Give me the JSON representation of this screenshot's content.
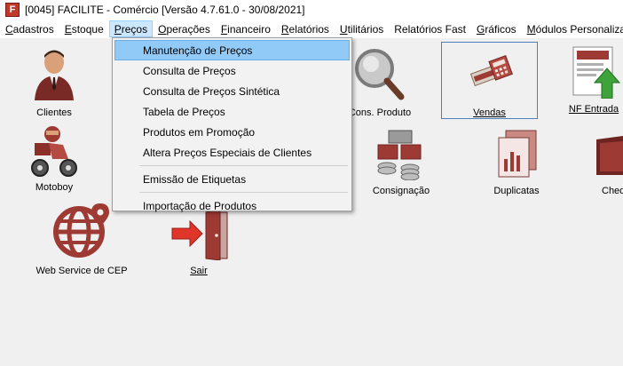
{
  "window": {
    "title": "[0045] FACILITE - Comércio [Versão 4.7.61.0 - 30/08/2021]",
    "icon_letter": "F"
  },
  "menubar": {
    "items": [
      {
        "pre": "",
        "u": "C",
        "post": "adastros"
      },
      {
        "pre": "",
        "u": "E",
        "post": "stoque"
      },
      {
        "pre": "",
        "u": "P",
        "post": "reços"
      },
      {
        "pre": "",
        "u": "O",
        "post": "perações"
      },
      {
        "pre": "",
        "u": "F",
        "post": "inanceiro"
      },
      {
        "pre": "",
        "u": "R",
        "post": "elatórios"
      },
      {
        "pre": "",
        "u": "U",
        "post": "tilitários"
      },
      {
        "pre": "Relatórios Fast",
        "u": "",
        "post": ""
      },
      {
        "pre": "",
        "u": "G",
        "post": "ráficos"
      },
      {
        "pre": "",
        "u": "M",
        "post": "ódulos Personaliza"
      }
    ]
  },
  "dropdown": {
    "items": [
      "Manutenção de Preços",
      "Consulta de Preços",
      "Consulta de Preços Sintética",
      "Tabela de Preços",
      "Produtos em Promoção",
      "Altera Preços Especiais de Clientes",
      "Emissão de Etiquetas",
      "Importação de Produtos"
    ]
  },
  "shortcuts": {
    "clientes": "Clientes",
    "cons_produto": "Cons. Produto",
    "vendas": "Vendas",
    "nf_entrada": "NF Entrada",
    "motoboy": "Motoboy",
    "consignacao": "Consignação",
    "duplicatas": "Duplicatas",
    "cheques": "Cheq",
    "web_service_cep": "Web Service de CEP",
    "sair": "Sair"
  },
  "colors": {
    "accent": "#91c9f7",
    "icon_red": "#9e3a34",
    "icon_gray": "#9a9a9a"
  }
}
